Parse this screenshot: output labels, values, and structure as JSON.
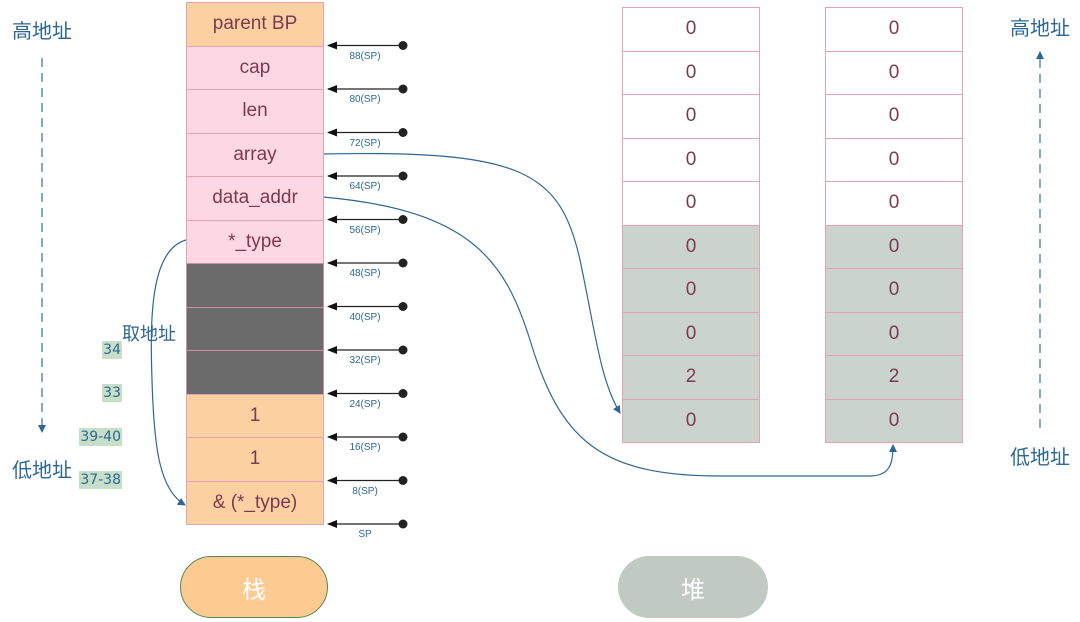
{
  "colors": {
    "stack_orange": "#fdd0a2",
    "stack_pink": "#fdd7e4",
    "stack_dark": "#6b6b6b",
    "heap_white": "#ffffff",
    "heap_gray": "#cbd3cd",
    "border": "#e3a3b3",
    "text": "#7a3b52",
    "blue": "#2e6794"
  },
  "left_axis": {
    "top_label": "高地址",
    "bottom_label": "低地址",
    "direction": "down"
  },
  "right_axis": {
    "top_label": "高地址",
    "bottom_label": "低地址",
    "direction": "up"
  },
  "take_address_label": "取地址",
  "stack": {
    "cells": [
      {
        "label": "parent BP",
        "kind": "orange"
      },
      {
        "label": "cap",
        "kind": "pink"
      },
      {
        "label": "len",
        "kind": "pink"
      },
      {
        "label": "array",
        "kind": "pink"
      },
      {
        "label": "data_addr",
        "kind": "pink"
      },
      {
        "label": "*_type",
        "kind": "pink"
      },
      {
        "label": "",
        "kind": "dark"
      },
      {
        "label": "",
        "kind": "dark"
      },
      {
        "label": "",
        "kind": "dark"
      },
      {
        "label": "1",
        "kind": "orange"
      },
      {
        "label": "1",
        "kind": "orange"
      },
      {
        "label": "& (*_type)",
        "kind": "orange"
      }
    ],
    "sp_offsets": [
      "88(SP)",
      "80(SP)",
      "72(SP)",
      "64(SP)",
      "56(SP)",
      "48(SP)",
      "40(SP)",
      "32(SP)",
      "24(SP)",
      "16(SP)",
      "8(SP)",
      "SP"
    ]
  },
  "line_numbers": [
    {
      "text": "34",
      "row": 8
    },
    {
      "text": "33",
      "row": 9
    },
    {
      "text": "39-40",
      "row": 10
    },
    {
      "text": "37-38",
      "row": 11
    }
  ],
  "heap_left": {
    "cells": [
      {
        "value": "0",
        "kind": "white"
      },
      {
        "value": "0",
        "kind": "white"
      },
      {
        "value": "0",
        "kind": "white"
      },
      {
        "value": "0",
        "kind": "white"
      },
      {
        "value": "0",
        "kind": "white"
      },
      {
        "value": "0",
        "kind": "gray"
      },
      {
        "value": "0",
        "kind": "gray"
      },
      {
        "value": "0",
        "kind": "gray"
      },
      {
        "value": "2",
        "kind": "gray"
      },
      {
        "value": "0",
        "kind": "gray"
      }
    ]
  },
  "heap_right": {
    "cells": [
      {
        "value": "0",
        "kind": "white"
      },
      {
        "value": "0",
        "kind": "white"
      },
      {
        "value": "0",
        "kind": "white"
      },
      {
        "value": "0",
        "kind": "white"
      },
      {
        "value": "0",
        "kind": "white"
      },
      {
        "value": "0",
        "kind": "gray"
      },
      {
        "value": "0",
        "kind": "gray"
      },
      {
        "value": "0",
        "kind": "gray"
      },
      {
        "value": "2",
        "kind": "gray"
      },
      {
        "value": "0",
        "kind": "gray"
      }
    ]
  },
  "legend": {
    "stack_label": "栈",
    "heap_label": "堆"
  }
}
